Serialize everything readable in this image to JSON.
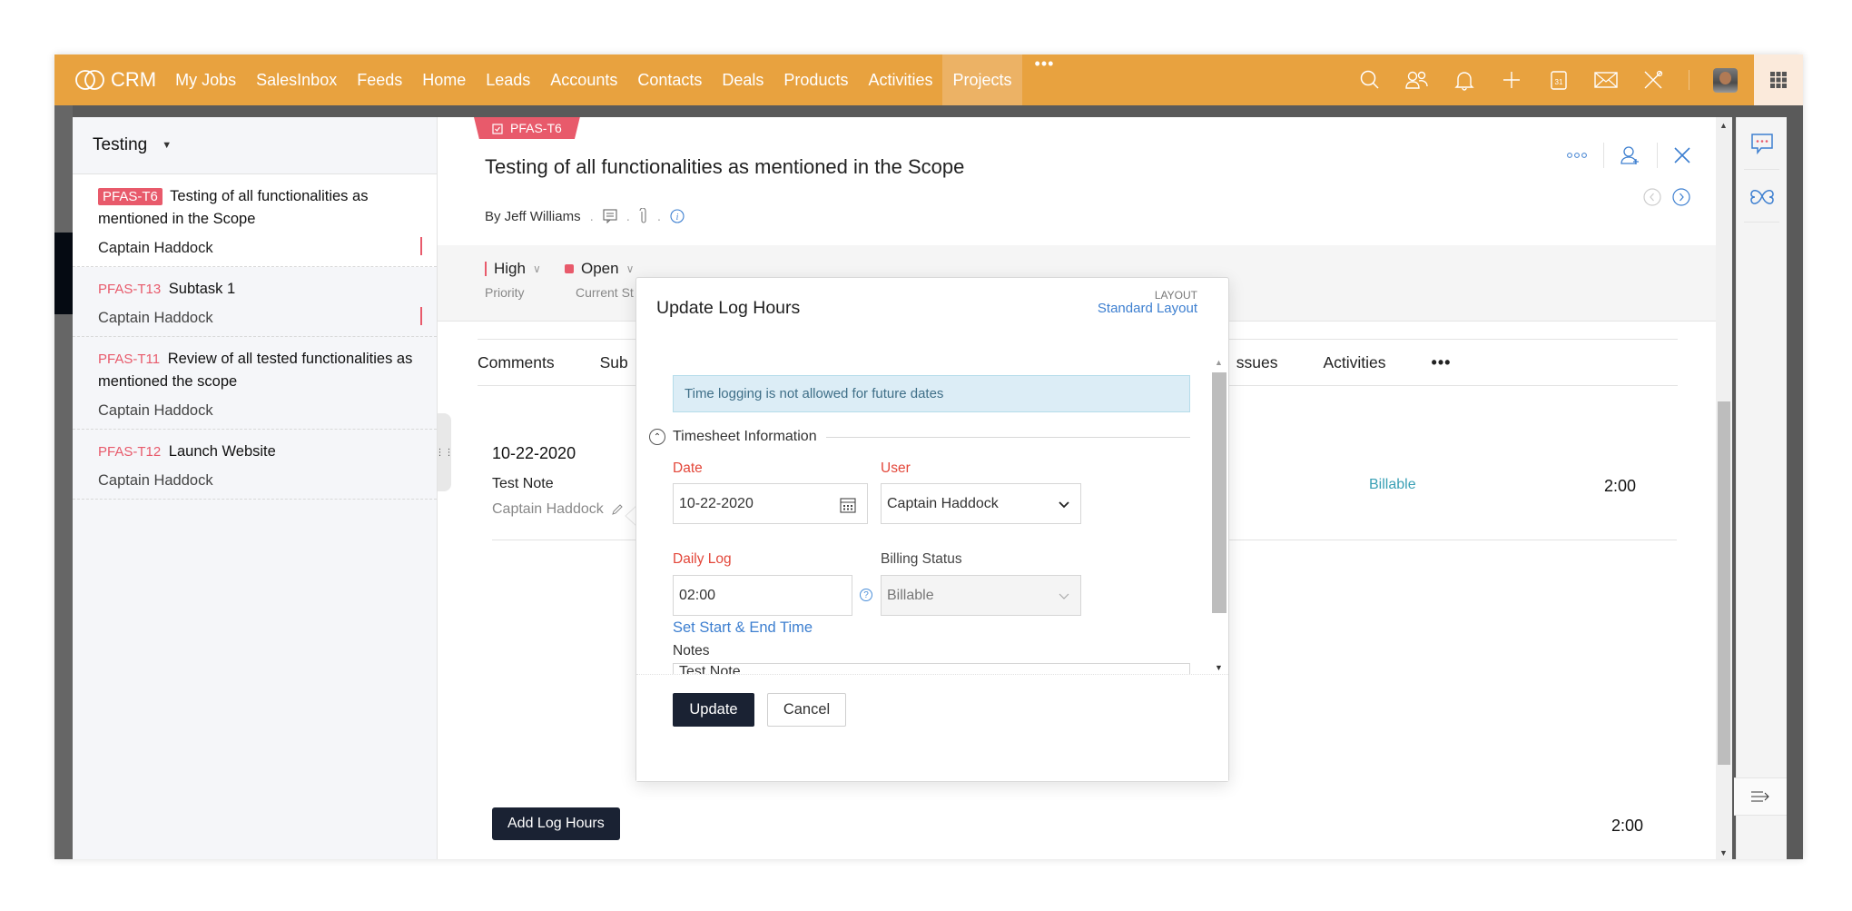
{
  "topbar": {
    "brand": "CRM",
    "nav": [
      "My Jobs",
      "SalesInbox",
      "Feeds",
      "Home",
      "Leads",
      "Accounts",
      "Contacts",
      "Deals",
      "Products",
      "Activities",
      "Projects"
    ],
    "active_nav": "Projects",
    "more": "•••",
    "icons": [
      "search-icon",
      "contacts-icon",
      "bell-icon",
      "plus-icon",
      "calendar-icon",
      "mail-icon",
      "tools-icon",
      "avatar",
      "apps-grid-icon"
    ],
    "brand_color": "#e8a23f"
  },
  "left_panel": {
    "title": "Testing",
    "tasks": [
      {
        "id": "PFAS-T6",
        "title": "Testing of all functionalities as mentioned in the Scope",
        "owner": "Captain Haddock",
        "selected": true
      },
      {
        "id": "PFAS-T13",
        "title": "Subtask 1",
        "owner": "Captain Haddock",
        "selected": false
      },
      {
        "id": "PFAS-T11",
        "title": "Review of all tested functionalities as mentioned the scope",
        "owner": "Captain Haddock",
        "selected": false
      },
      {
        "id": "PFAS-T12",
        "title": "Launch Website",
        "owner": "Captain Haddock",
        "selected": false
      }
    ]
  },
  "detail": {
    "ribbon": "PFAS-T6",
    "title": "Testing of all functionalities as mentioned in the Scope",
    "author": "By Jeff Williams",
    "priority": {
      "value": "High",
      "label": "Priority"
    },
    "status": {
      "value": "Open",
      "label": "Current St"
    },
    "tabs": [
      "Comments",
      "Sub",
      "ssues",
      "Activities"
    ],
    "tab_more": "•••",
    "log": {
      "date": "10-22-2020",
      "note": "Test Note",
      "user": "Captain Haddock",
      "billing": "Billable",
      "hours": "2:00"
    },
    "add_log_label": "Add Log Hours",
    "total_hours": "2:00",
    "accent_color": "#e85a6b"
  },
  "modal": {
    "title": "Update Log Hours",
    "layout_label": "LAYOUT",
    "layout_value": "Standard Layout",
    "alert": "Time logging is not allowed for future dates",
    "section": "Timesheet Information",
    "fields": {
      "date_label": "Date",
      "date_value": "10-22-2020",
      "user_label": "User",
      "user_value": "Captain Haddock",
      "daily_log_label": "Daily Log",
      "daily_log_value": "02:00",
      "billing_label": "Billing Status",
      "billing_value": "Billable",
      "set_time_link": "Set Start & End Time",
      "notes_label": "Notes",
      "notes_value": "Test Note"
    },
    "update_label": "Update",
    "cancel_label": "Cancel"
  }
}
